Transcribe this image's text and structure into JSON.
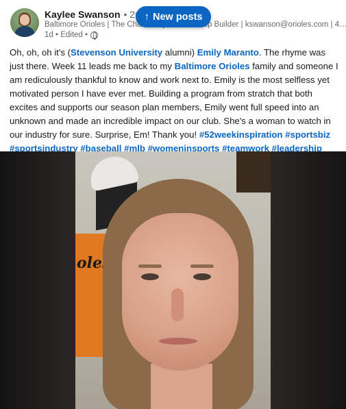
{
  "author": {
    "name": "Kaylee Swanson",
    "degree": "• 2nd",
    "headline": "Baltimore Orioles | The Charm City Relationship Builder | kswanson@orioles.com | 4…",
    "time": "1d • Edited •"
  },
  "new_posts_button": {
    "arrow": "↑",
    "label": "New posts"
  },
  "post": {
    "t1": "Oh, oh, oh it's (",
    "m1": "Stevenson University",
    "t2": " alumni) ",
    "m2": "Emily Maranto",
    "t3": ". The rhyme was just there. Week 11 leads me back to my ",
    "m3": "Baltimore Orioles",
    "t4": " family and someone I am rediculously thankful to know and work next to. Emily is the most selfless yet motivated person I have ever met. Building a program from stratch that both excites and supports our season plan members, Emily went full speed into an unknown and made an incredible impact on our club. She's a woman to watch in our industry for sure. Surprise, Em! Thank you! ",
    "hashtags": [
      "#52weekinspiration",
      "#sportsbiz",
      "#sportsindustry",
      "#baseball",
      "#mlb",
      "#womeninsports",
      "#teamwork",
      "#leadership"
    ]
  },
  "video": {
    "poster_text": "oles"
  },
  "colors": {
    "link": "#0a66c2",
    "button_bg": "#0a66c2"
  }
}
